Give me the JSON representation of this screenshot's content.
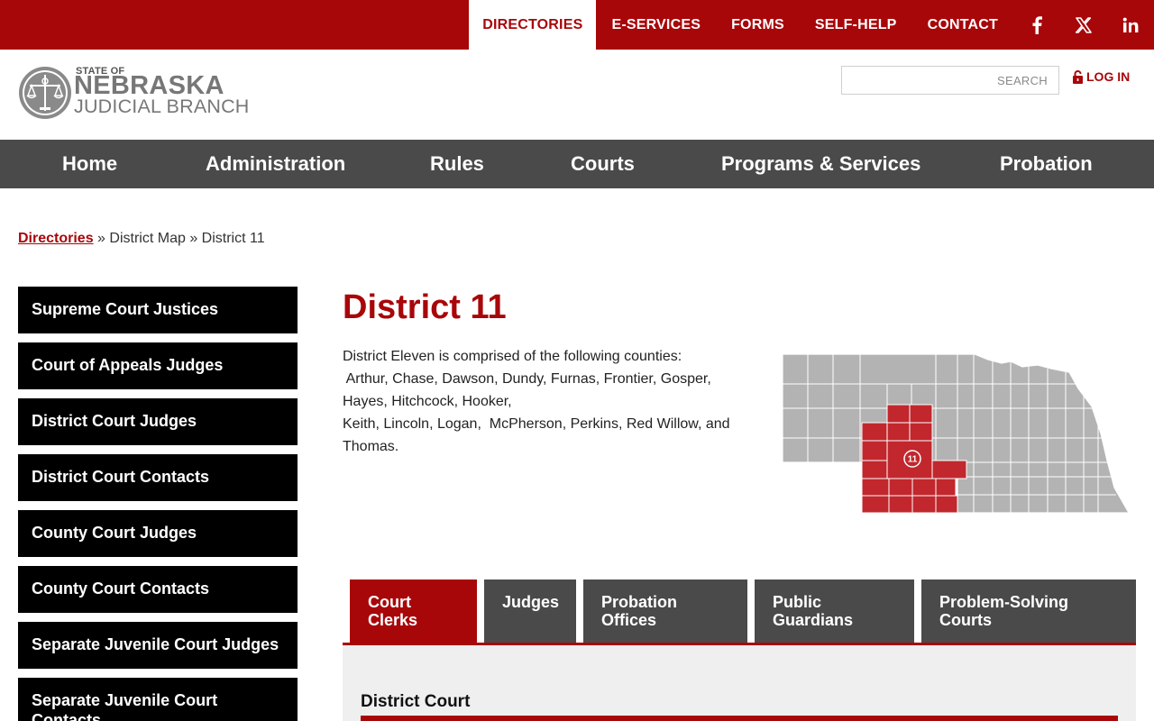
{
  "top_nav": {
    "items": [
      {
        "label": "DIRECTORIES",
        "active": true
      },
      {
        "label": "E-SERVICES",
        "active": false
      },
      {
        "label": "FORMS",
        "active": false
      },
      {
        "label": "SELF-HELP",
        "active": false
      },
      {
        "label": "CONTACT",
        "active": false
      }
    ],
    "social_icons": [
      "facebook-icon",
      "x-twitter-icon",
      "linkedin-icon"
    ]
  },
  "logo": {
    "line1": "STATE OF",
    "line2": "NEBRASKA",
    "line3": "JUDICIAL BRANCH"
  },
  "search": {
    "placeholder": "SEARCH",
    "value": ""
  },
  "login": {
    "label": "LOG IN",
    "icon": "lock-icon"
  },
  "main_nav": {
    "items": [
      "Home",
      "Administration",
      "Rules",
      "Courts",
      "Programs & Services",
      "Probation"
    ]
  },
  "breadcrumb": {
    "link": "Directories",
    "separator": "»",
    "item2": "District Map",
    "item3": "District 11"
  },
  "sidebar": {
    "items": [
      "Supreme Court Justices",
      "Court of Appeals Judges",
      "District Court Judges",
      "District Court Contacts",
      "County Court Judges",
      "County Court Contacts",
      "Separate Juvenile Court Judges",
      "Separate Juvenile Court Contacts"
    ]
  },
  "content": {
    "title": "District 11",
    "description_lines": [
      "District Eleven is comprised of the following counties:",
      " Arthur, Chase, Dawson, Dundy, Furnas, Frontier, Gosper,",
      "Hayes, Hitchcock, Hooker,",
      "Keith, Lincoln, Logan,  McPherson, Perkins, Red Willow, and",
      "Thomas."
    ]
  },
  "map": {
    "district_label": "11",
    "highlight_color": "#c1272d",
    "base_color": "#b3b3b3"
  },
  "tabs": {
    "items": [
      {
        "line1": "Court",
        "line2": "Clerks",
        "active": true
      },
      {
        "line1": "Judges",
        "line2": "",
        "active": false
      },
      {
        "line1": "Probation",
        "line2": "Offices",
        "active": false
      },
      {
        "line1": "Public",
        "line2": "Guardians",
        "active": false
      },
      {
        "line1": "Problem-Solving",
        "line2": "Courts",
        "active": false
      }
    ]
  },
  "panel": {
    "heading": "District Court"
  },
  "colors": {
    "brand_red": "#a8070a",
    "nav_gray": "#4a4a4a",
    "sidebar_black": "#000000"
  }
}
